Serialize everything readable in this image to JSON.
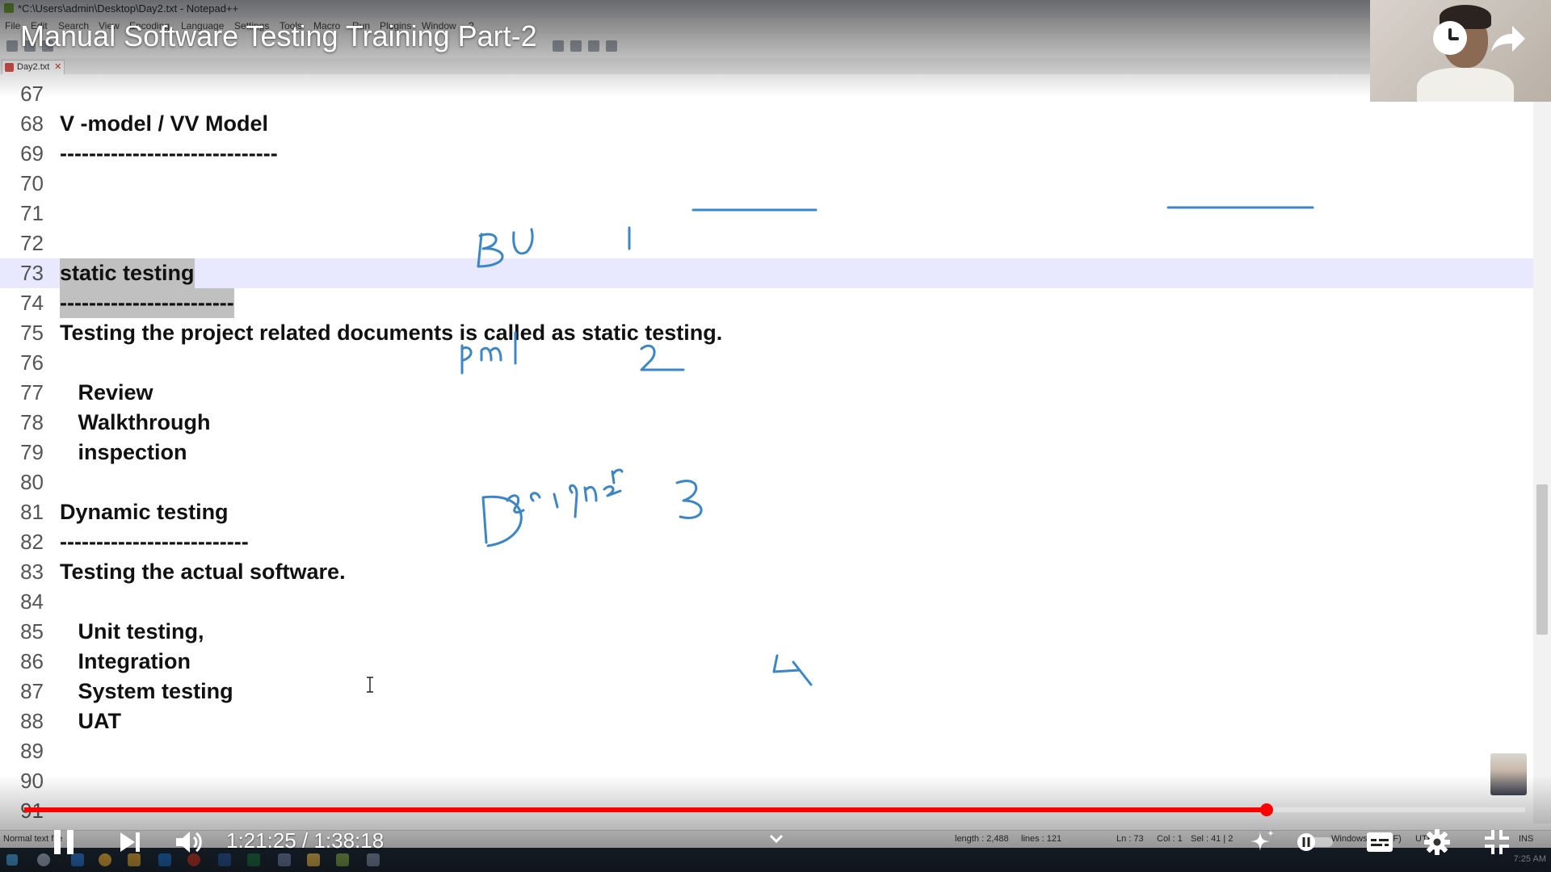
{
  "notepad": {
    "window_title": "*C:\\Users\\admin\\Desktop\\Day2.txt - Notepad++",
    "menu": [
      "File",
      "Edit",
      "Search",
      "View",
      "Encoding",
      "Language",
      "Settings",
      "Tools",
      "Macro",
      "Run",
      "Plugins",
      "Window",
      "?"
    ],
    "tab_label": "Day2.txt",
    "lines": [
      {
        "num": "67",
        "text": ""
      },
      {
        "num": "68",
        "text": "V -model / VV Model"
      },
      {
        "num": "69",
        "text": "------------------------------"
      },
      {
        "num": "70",
        "text": ""
      },
      {
        "num": "71",
        "text": ""
      },
      {
        "num": "72",
        "text": ""
      },
      {
        "num": "73",
        "text": "static testing"
      },
      {
        "num": "74",
        "text": "------------------------"
      },
      {
        "num": "75",
        "text": "Testing the project related documents is called as static testing."
      },
      {
        "num": "76",
        "text": ""
      },
      {
        "num": "77",
        "text": "   Review"
      },
      {
        "num": "78",
        "text": "   Walkthrough"
      },
      {
        "num": "79",
        "text": "   inspection"
      },
      {
        "num": "80",
        "text": ""
      },
      {
        "num": "81",
        "text": "Dynamic testing"
      },
      {
        "num": "82",
        "text": "--------------------------"
      },
      {
        "num": "83",
        "text": "Testing the actual software."
      },
      {
        "num": "84",
        "text": ""
      },
      {
        "num": "85",
        "text": "   Unit testing,"
      },
      {
        "num": "86",
        "text": "   Integration"
      },
      {
        "num": "87",
        "text": "   System testing"
      },
      {
        "num": "88",
        "text": "   UAT"
      },
      {
        "num": "89",
        "text": ""
      },
      {
        "num": "90",
        "text": ""
      },
      {
        "num": "91",
        "text": ""
      }
    ],
    "current_line": "73",
    "status": {
      "lang": "Normal text file",
      "length": "length : 2,488",
      "lines": "lines : 121",
      "ln": "Ln : 73",
      "col": "Col : 1",
      "sel": "Sel : 41 | 2",
      "eol": "Windows (CR LF)",
      "enc": "UTF-8",
      "ins": "INS"
    },
    "clock": "7:25 AM"
  },
  "annotations": [
    "BU",
    "1",
    "pm",
    "2",
    "Designer",
    "3",
    "4"
  ],
  "player": {
    "title": "Manual Software Testing Training Part-2",
    "current_time": "1:21:25",
    "separator": " / ",
    "duration": "1:38:18",
    "progress": 0.8279,
    "buttons": [
      "pause",
      "next",
      "volume",
      "autoplay",
      "subtitles",
      "settings",
      "exit-fullscreen"
    ]
  },
  "colors": {
    "progress": "#ff0000",
    "current_line_bg": "#e8e8ff",
    "selection": "#c0c0c0",
    "ink": "#3a86c8"
  }
}
